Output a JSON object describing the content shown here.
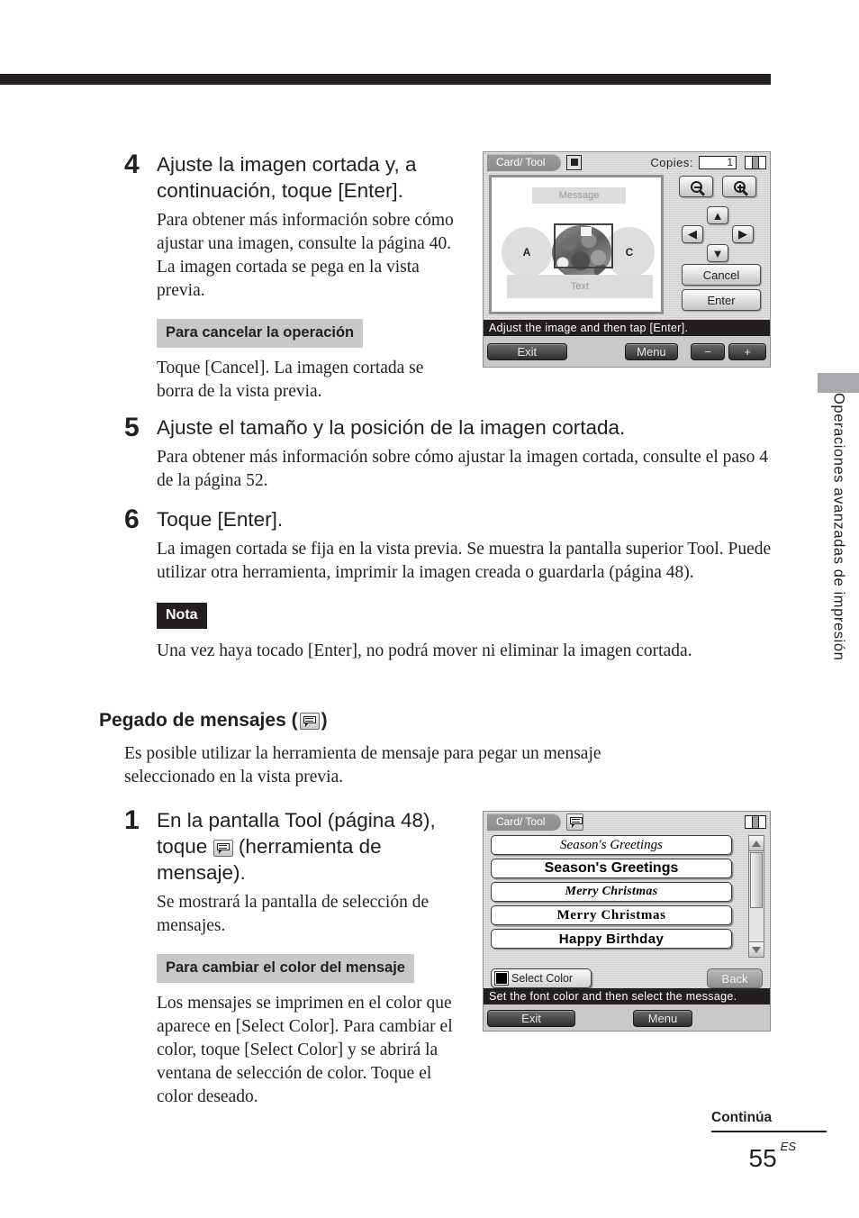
{
  "page": {
    "footer_continued": "Continúa",
    "page_number": "55",
    "page_lang": "ES",
    "side_tab_label": "Operaciones avanzadas de impresión"
  },
  "steps": [
    {
      "number": "4",
      "heading": "Ajuste la imagen cortada y, a continuación, toque [Enter].",
      "body": "Para obtener más información sobre cómo ajustar una imagen, consulte la página 40. La imagen cortada se pega en la vista previa.",
      "subheading": "Para cancelar la operación",
      "subbody": "Toque [Cancel].  La imagen cortada se borra de la vista previa."
    },
    {
      "number": "5",
      "heading": "Ajuste el tamaño y la posición de la imagen cortada.",
      "body": "Para obtener más información sobre cómo ajustar la imagen cortada, consulte el paso 4 de la página 52."
    },
    {
      "number": "6",
      "heading": "Toque [Enter].",
      "body": "La imagen cortada se fija en la vista previa.  Se muestra la pantalla superior Tool.  Puede utilizar otra herramienta, imprimir la imagen creada o guardarla (página 48).",
      "note_label": "Nota",
      "note_body": "Una vez haya tocado [Enter], no podrá mover ni eliminar la imagen cortada."
    }
  ],
  "section": {
    "title_before": "Pegado de mensajes (",
    "title_after": ")",
    "intro": "Es posible utilizar la herramienta de mensaje para pegar un mensaje seleccionado en la vista previa."
  },
  "step1": {
    "number": "1",
    "heading_part1": "En la pantalla Tool (página 48), toque",
    "heading_part2": "(herramienta de mensaje).",
    "body": "Se mostrará la pantalla de selección de mensajes.",
    "subheading": "Para cambiar el color del mensaje",
    "subbody": "Los mensajes se imprimen en el color que aparece en [Select Color]. Para cambiar el color, toque [Select Color] y se abrirá la ventana de selección de color. Toque el color deseado."
  },
  "screen1": {
    "tab_label": "Card/ Tool",
    "copies_label": "Copies:",
    "copies_value": "1",
    "preview": {
      "message_placeholder": "Message",
      "text_placeholder": "Text",
      "circle_a": "A",
      "circle_c": "C"
    },
    "cancel_label": "Cancel",
    "enter_label": "Enter",
    "status": "Adjust the image and then tap [Enter].",
    "exit_label": "Exit",
    "menu_label": "Menu",
    "minus_label": "−",
    "plus_label": "+"
  },
  "screen2": {
    "tab_label": "Card/ Tool",
    "messages": [
      "Season's Greetings",
      "Season's Greetings",
      "Merry Christmas",
      "Merry Christmas",
      "Happy Birthday"
    ],
    "select_color_label": "Select Color",
    "select_color_value": "#000000",
    "back_label": "Back",
    "status": "Set the font color and then select the message.",
    "exit_label": "Exit",
    "menu_label": "Menu"
  }
}
